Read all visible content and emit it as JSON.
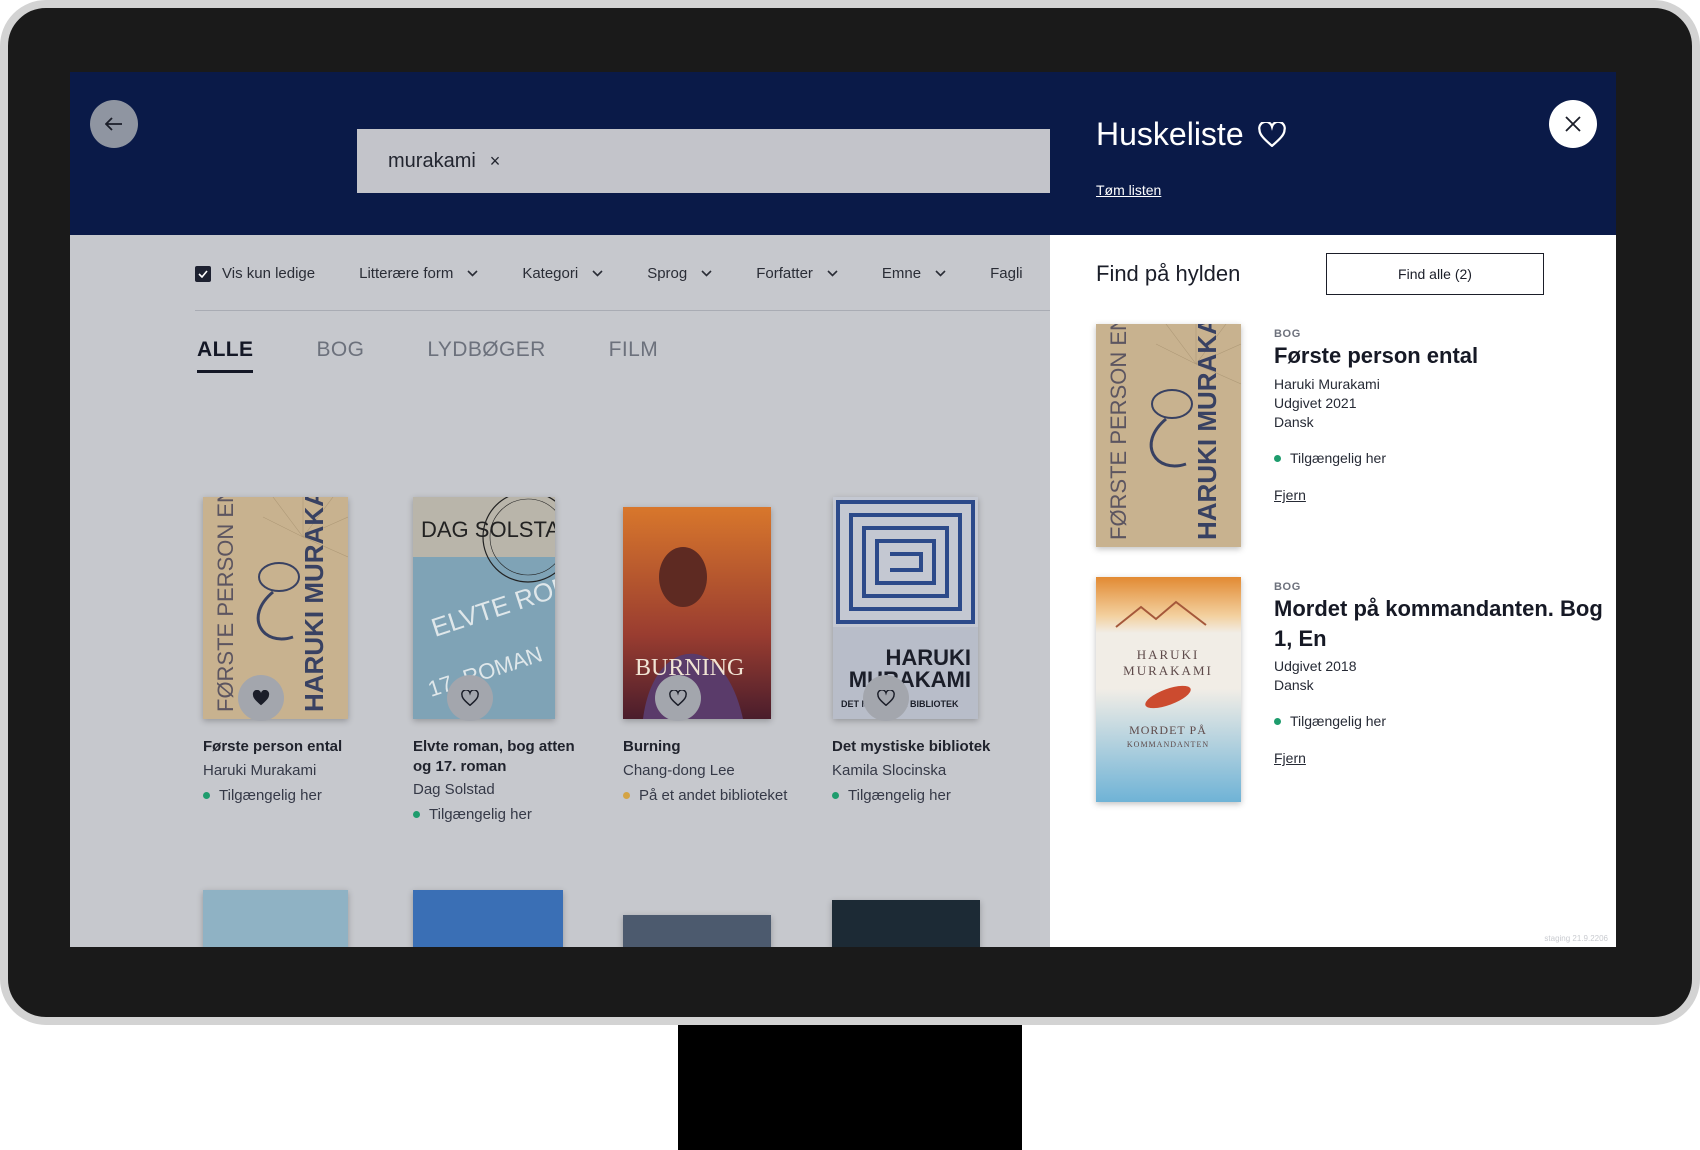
{
  "search": {
    "value": "murakami",
    "clear_icon": "×"
  },
  "filters": [
    {
      "label": "Vis kun ledige"
    },
    {
      "label": "Litterære form"
    },
    {
      "label": "Kategori"
    },
    {
      "label": "Sprog"
    },
    {
      "label": "Forfatter"
    },
    {
      "label": "Emne"
    },
    {
      "label": "Fagli"
    }
  ],
  "tabs": [
    "ALLE",
    "BOG",
    "LYDBØGER",
    "FILM"
  ],
  "results": [
    {
      "title": "Første person ental",
      "author": "Haruki Murakami",
      "status": "Tilgængelig her",
      "status_color": "#1e9c6d",
      "saved": true
    },
    {
      "title": "Elvte roman, bog atten og 17. roman",
      "author": "Dag Solstad",
      "status": "Tilgængelig her",
      "status_color": "#1e9c6d",
      "saved": false
    },
    {
      "title": "Burning",
      "author": "Chang-dong Lee",
      "status": "På et andet biblioteket",
      "status_color": "#d4a445",
      "saved": false
    },
    {
      "title": "Det mystiske bibliotek",
      "author": "Kamila Slocinska",
      "status": "Tilgængelig her",
      "status_color": "#1e9c6d",
      "saved": false
    }
  ],
  "covers": {
    "c1_left": "FØRSTE PERSON ENTAL",
    "c1_right": "HARUKI MURAKAMI",
    "c2_top": "DAG SOLSTAD",
    "c2_mid": "ELVTE ROMAN",
    "c2_bottom": "17. ROMAN",
    "c3_text": "BURNING",
    "c4_line1": "HARUKI",
    "c4_line2": "MURAKAMI",
    "c4_line3": "DET MYSTISKE BIBLIOTEK",
    "m1": "HARUKI",
    "m2": "MURAKAMI",
    "m3": "MORDET PÅ",
    "m4": "KOMMANDANTEN"
  },
  "panel": {
    "title": "Huskeliste",
    "clear_link": "Tøm listen",
    "find_heading": "Find på hylden",
    "find_all_label": "Find alle (2)",
    "items": [
      {
        "type": "BOG",
        "title": "Første person ental",
        "author": "Haruki Murakami",
        "published": "Udgivet 2021",
        "language": "Dansk",
        "status": "Tilgængelig her",
        "remove": "Fjern"
      },
      {
        "type": "BOG",
        "title": "Mordet på kommandanten. Bog 1, En",
        "published": "Udgivet 2018",
        "language": "Dansk",
        "status": "Tilgængelig her",
        "remove": "Fjern"
      }
    ],
    "staging": "staging 21.9.2206"
  },
  "colors": {
    "navy": "#0a1a48",
    "available": "#1e9c6d",
    "other": "#d4a445"
  }
}
